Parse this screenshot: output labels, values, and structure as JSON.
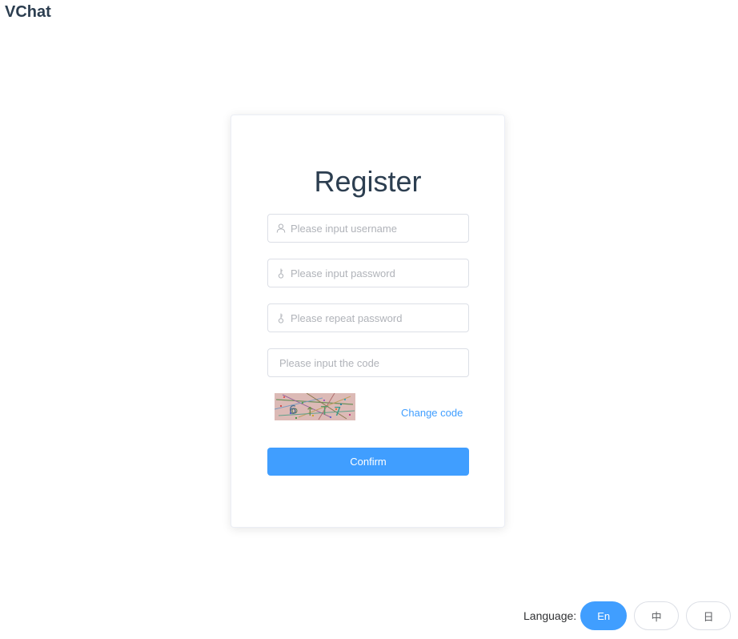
{
  "app": {
    "title": "VChat"
  },
  "register": {
    "title": "Register",
    "username_placeholder": "Please input username",
    "password_placeholder": "Please input password",
    "repeat_password_placeholder": "Please repeat password",
    "code_placeholder": "Please input the code",
    "change_code_label": "Change code",
    "confirm_label": "Confirm"
  },
  "language": {
    "label": "Language:",
    "options": [
      {
        "label": "En",
        "active": true
      },
      {
        "label": "中",
        "active": false
      },
      {
        "label": "日",
        "active": false
      }
    ]
  },
  "icons": {
    "username": "user-icon",
    "password": "key-icon",
    "repeat_password": "key-icon"
  },
  "colors": {
    "primary": "#409eff",
    "title": "#2c3e50",
    "border": "#dcdfe6",
    "placeholder": "#b0b3b9"
  }
}
